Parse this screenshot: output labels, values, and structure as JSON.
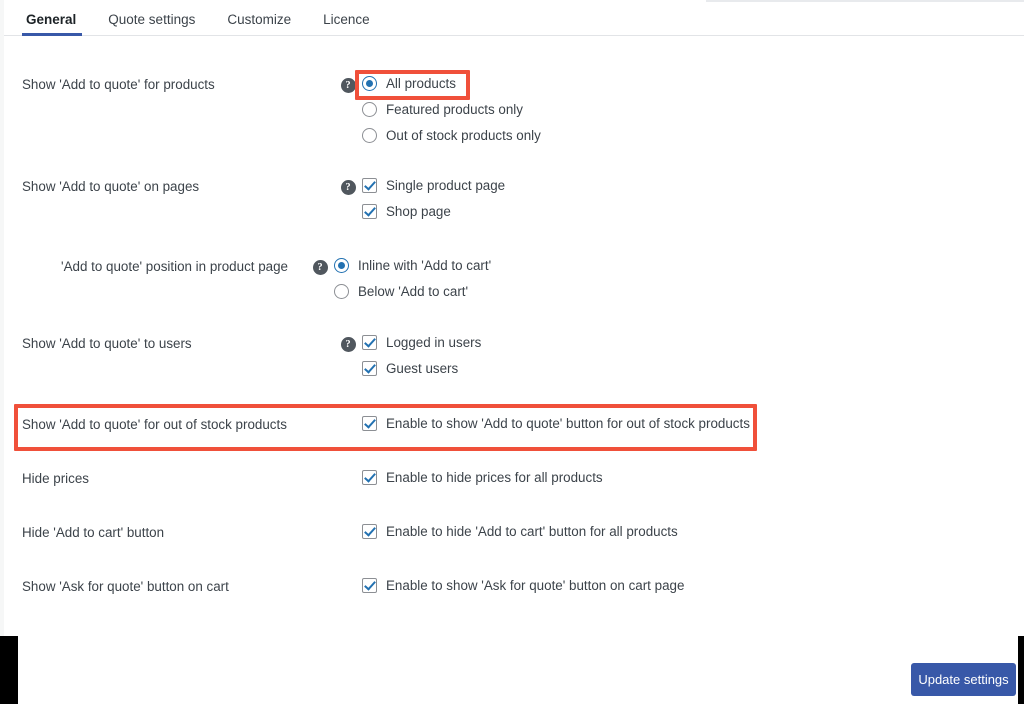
{
  "tabs": [
    {
      "label": "General",
      "active": true
    },
    {
      "label": "Quote settings",
      "active": false
    },
    {
      "label": "Customize",
      "active": false
    },
    {
      "label": "Licence",
      "active": false
    }
  ],
  "rows": {
    "products": {
      "label": "Show 'Add to quote' for products",
      "help": "?",
      "options": [
        {
          "label": "All products",
          "checked": true
        },
        {
          "label": "Featured products only",
          "checked": false
        },
        {
          "label": "Out of stock products only",
          "checked": false
        }
      ]
    },
    "pages": {
      "label": "Show 'Add to quote' on pages",
      "help": "?",
      "options": [
        {
          "label": "Single product page",
          "checked": true
        },
        {
          "label": "Shop page",
          "checked": true
        }
      ]
    },
    "position": {
      "label": "'Add to quote' position in product page",
      "help": "?",
      "options": [
        {
          "label": "Inline with 'Add to cart'",
          "checked": true
        },
        {
          "label": "Below 'Add to cart'",
          "checked": false
        }
      ]
    },
    "users": {
      "label": "Show 'Add to quote' to users",
      "help": "?",
      "options": [
        {
          "label": "Logged in users",
          "checked": true
        },
        {
          "label": "Guest users",
          "checked": true
        }
      ]
    },
    "outofstock": {
      "label": "Show 'Add to quote' for out of stock products",
      "options": [
        {
          "label": "Enable to show 'Add to quote' button for out of stock products",
          "checked": true
        }
      ]
    },
    "hideprices": {
      "label": "Hide prices",
      "options": [
        {
          "label": "Enable to hide prices for all products",
          "checked": true
        }
      ]
    },
    "hideaddtocart": {
      "label": "Hide 'Add to cart' button",
      "options": [
        {
          "label": "Enable to hide 'Add to cart' button for all products",
          "checked": true
        }
      ]
    },
    "askforquote": {
      "label": "Show 'Ask for quote' button on cart",
      "options": [
        {
          "label": "Enable to show 'Ask for quote' button on cart page",
          "checked": true
        }
      ]
    }
  },
  "footer": {
    "update_label": "Update settings"
  },
  "colors": {
    "accent_blue": "#3858a8",
    "control_blue": "#2271b1",
    "annotation_red": "#f0503a"
  }
}
